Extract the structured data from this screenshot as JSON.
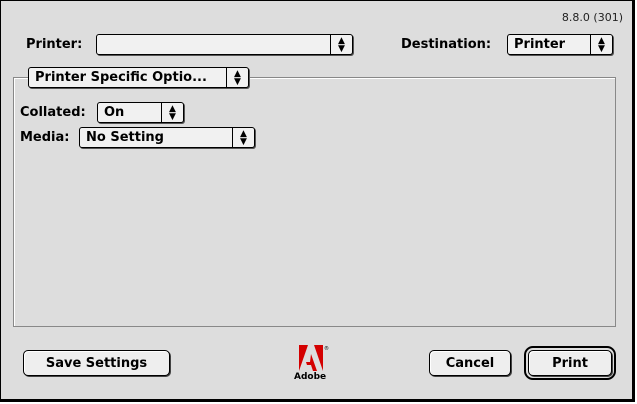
{
  "version": "8.8.0 (301)",
  "printer": {
    "label": "Printer:",
    "value": ""
  },
  "destination": {
    "label": "Destination:",
    "value": "Printer"
  },
  "section_popup": {
    "value": "Printer Specific Optio..."
  },
  "collated": {
    "label": "Collated:",
    "value": "On"
  },
  "media": {
    "label": "Media:",
    "value": "No Setting"
  },
  "buttons": {
    "save_settings": "Save Settings",
    "cancel": "Cancel",
    "print": "Print"
  },
  "logo": {
    "text": "Adobe",
    "icon": "adobe-logo-icon"
  }
}
